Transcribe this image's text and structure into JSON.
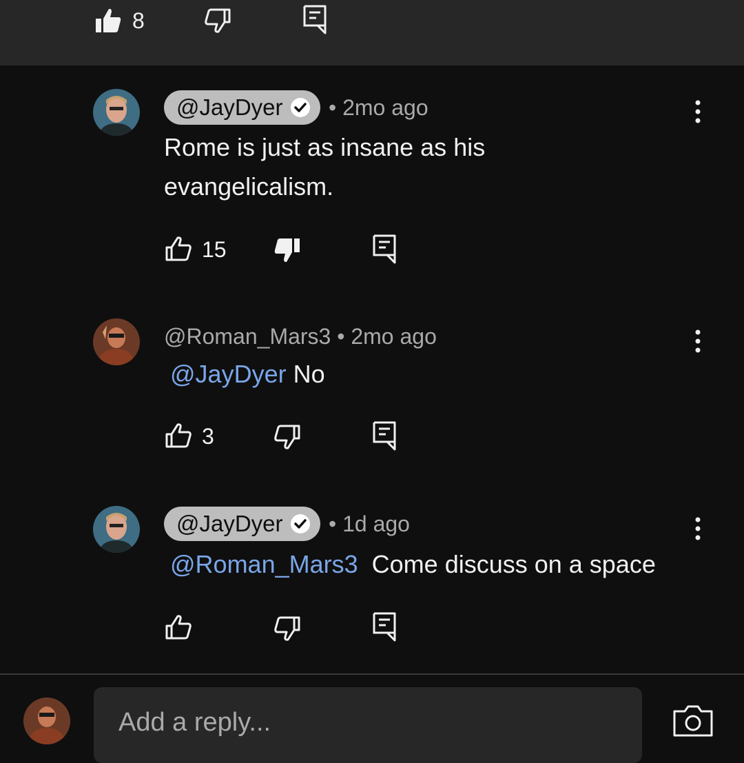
{
  "top_actions": {
    "like_count": "8"
  },
  "comments": [
    {
      "author": "@JayDyer",
      "verified": true,
      "time": "2mo ago",
      "text": "Rome is just as insane as his evangelicalism.",
      "like_count": "15",
      "disliked": true
    },
    {
      "author": "@Roman_Mars3",
      "verified": false,
      "time": "2mo ago",
      "mention": "@JayDyer",
      "text": "No",
      "like_count": "3",
      "disliked": false
    },
    {
      "author": "@JayDyer",
      "verified": true,
      "time": "1d ago",
      "mention": "@Roman_Mars3",
      "text": "Come discuss on a space",
      "like_count": "",
      "disliked": false
    }
  ],
  "reply_bar": {
    "placeholder": "Add a reply..."
  },
  "separator": "•",
  "colors": {
    "background": "#0f0f0f",
    "mention": "#7aa6e8",
    "chip": "#bdbdbd",
    "secondary_text": "#aaaaaa"
  },
  "icons": [
    "like-icon",
    "dislike-icon",
    "reply-icon",
    "verified-icon",
    "more-icon",
    "camera-icon"
  ]
}
